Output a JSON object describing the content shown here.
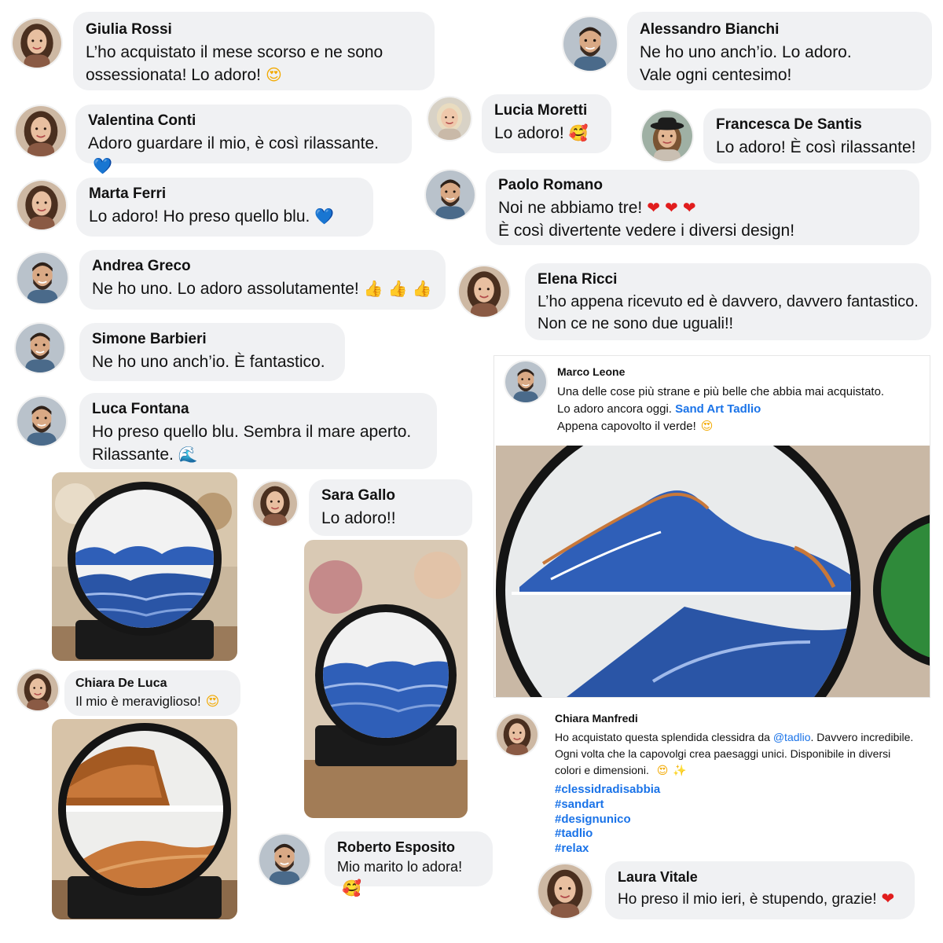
{
  "comments": {
    "giulia": {
      "name": "Giulia Rossi",
      "line1": "L’ho acquistato il mese scorso e ne sono",
      "line2": "ossessionata! Lo adoro!"
    },
    "alessandro": {
      "name": "Alessandro Bianchi",
      "line1": "Ne ho uno anch’io. Lo adoro.",
      "line2": "Vale ogni centesimo!"
    },
    "valentina": {
      "name": "Valentina Conti",
      "line1": "Adoro guardare il mio, è così rilassante."
    },
    "lucia": {
      "name": "Lucia Moretti",
      "line1": "Lo adoro!"
    },
    "francesca": {
      "name": "Francesca De Santis",
      "line1": "Lo adoro! È così rilassante!"
    },
    "marta": {
      "name": "Marta Ferri",
      "line1": "Lo adoro! Ho preso quello blu."
    },
    "paolo": {
      "name": "Paolo Romano",
      "line1": "Noi ne abbiamo tre!",
      "line2": "È così divertente vedere i diversi design!"
    },
    "andrea": {
      "name": "Andrea Greco",
      "line1": "Ne ho uno.  Lo adoro assolutamente!"
    },
    "elena": {
      "name": "Elena Ricci",
      "line1": "L’ho appena ricevuto ed è davvero, davvero fantastico.",
      "line2": "Non ce ne sono due uguali!!"
    },
    "simone": {
      "name": "Simone Barbieri",
      "line1": "Ne ho uno anch’io. È fantastico."
    },
    "luca": {
      "name": "Luca Fontana",
      "line1": "Ho preso quello blu. Sembra il mare aperto.",
      "line2": "Rilassante."
    },
    "sara": {
      "name": "Sara Gallo",
      "line1": "Lo adoro!!"
    },
    "chiara_dl": {
      "name": "Chiara De Luca",
      "line1": "Il mio è meraviglioso!"
    },
    "roberto": {
      "name": "Roberto Esposito",
      "line1": "Mio marito lo adora!"
    },
    "laura": {
      "name": "Laura Vitale",
      "line1": "Ho preso il mio ieri, è stupendo, grazie!"
    }
  },
  "marco_post": {
    "name": "Marco Leone",
    "line1": "Una delle cose più strane e più belle che abbia mai acquistato.",
    "line2": "Lo adoro ancora oggi.",
    "link": "Sand Art Tadlio",
    "line3": "Appena capovolto il verde!"
  },
  "chiara_post": {
    "name": "Chiara Manfredi",
    "text_pre": "Ho acquistato questa splendida clessidra da ",
    "mention": "@tadlio",
    "text_post": ". Davvero incredibile.",
    "line2": "Ogni volta che la capovolgi crea paesaggi unici. Disponibile in diversi",
    "line3": "colori e dimensioni.",
    "hashtags": [
      "#clessidradisabbia",
      "#sandart",
      "#designunico",
      "#tadlio",
      "#relax"
    ]
  },
  "emoji": {
    "heart_eyes": "😍",
    "smiling_hearts": "🥰",
    "blue_heart": "💙",
    "red_heart": "❤",
    "thumbs_up": "👍",
    "wave": "🌊",
    "sparkles": "✨"
  },
  "colors": {
    "bubble": "#f0f1f3",
    "link": "#1a73e8",
    "sand_blue": "#2f5fb8",
    "sand_orange": "#c8783a",
    "frame": "#141414"
  }
}
